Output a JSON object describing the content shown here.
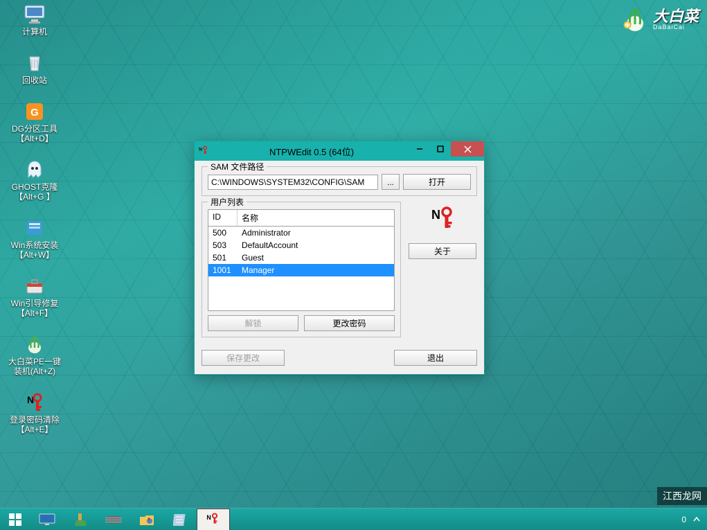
{
  "desktop_icons": [
    {
      "label": "计算机"
    },
    {
      "label": "回收站"
    },
    {
      "label": "DG分区工具\n【Alt+D】"
    },
    {
      "label": "GHOST克隆\n【Alt+G 】"
    },
    {
      "label": "Win系统安装\n【Alt+W】"
    },
    {
      "label": "Win引导修复\n【Alt+F】"
    },
    {
      "label": "大白菜PE一键\n装机(Alt+Z)"
    },
    {
      "label": "登录密码清除\n【Alt+E】"
    }
  ],
  "brand": {
    "cn": "大白菜",
    "en": "DaBaiCai"
  },
  "window": {
    "title": "NTPWEdit 0.5 (64位)",
    "sam_legend": "SAM 文件路径",
    "sam_path": "C:\\WINDOWS\\SYSTEM32\\CONFIG\\SAM",
    "browse": "...",
    "open": "打开",
    "userlist_legend": "用户列表",
    "columns": {
      "id": "ID",
      "name": "名称"
    },
    "users": [
      {
        "id": "500",
        "name": "Administrator",
        "selected": false
      },
      {
        "id": "503",
        "name": "DefaultAccount",
        "selected": false
      },
      {
        "id": "501",
        "name": "Guest",
        "selected": false
      },
      {
        "id": "1001",
        "name": "Manager",
        "selected": true
      }
    ],
    "unlock": "解锁",
    "change_pw": "更改密码",
    "about": "关于",
    "save": "保存更改",
    "exit": "退出"
  },
  "taskbar": {
    "tray_text": "0"
  },
  "watermark": "江西龙网"
}
